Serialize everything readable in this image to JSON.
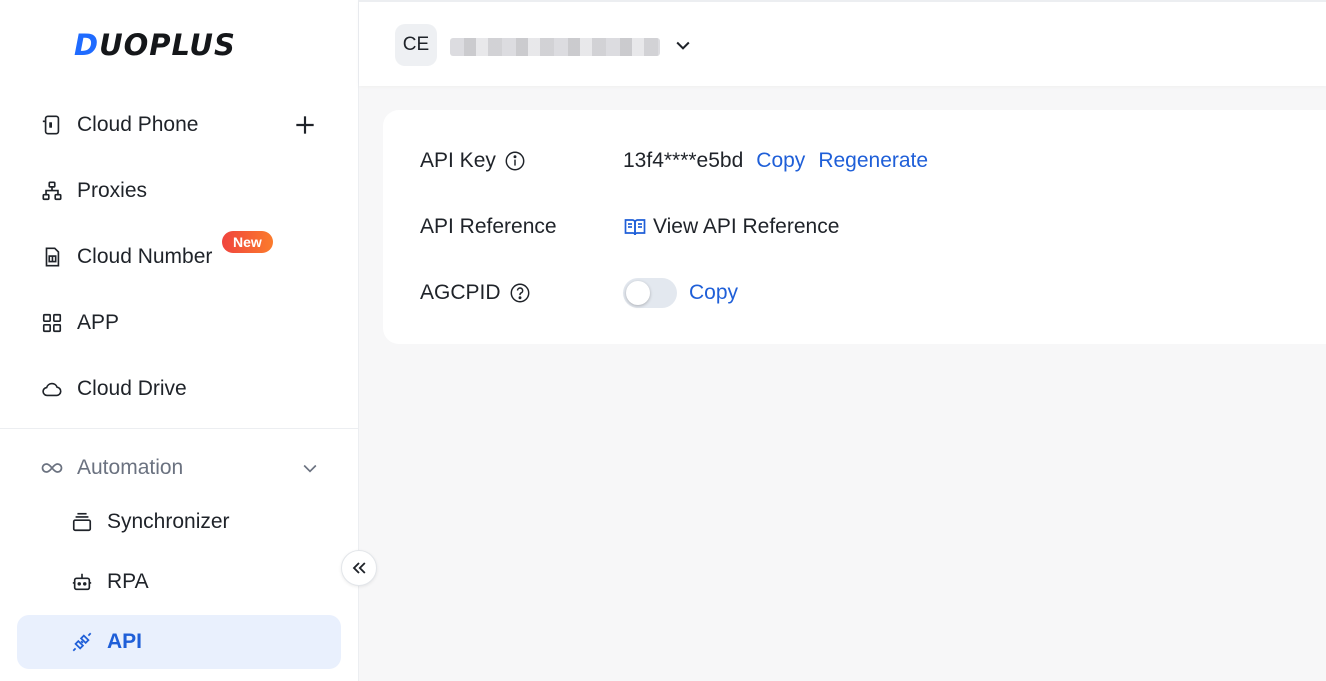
{
  "brand": {
    "logo_first": "D",
    "logo_rest": "UOPLUS"
  },
  "sidebar": {
    "items": [
      {
        "label": "Cloud Phone",
        "icon": "phone-icon"
      },
      {
        "label": "Proxies",
        "icon": "network-icon"
      },
      {
        "label": "Cloud Number",
        "icon": "sim-card-icon",
        "badge": "New"
      },
      {
        "label": "APP",
        "icon": "grid-icon"
      },
      {
        "label": "Cloud Drive",
        "icon": "cloud-icon"
      }
    ],
    "group": {
      "label": "Automation",
      "icon": "infinity-icon",
      "children": [
        {
          "label": "Synchronizer",
          "icon": "layers-icon"
        },
        {
          "label": "RPA",
          "icon": "robot-icon"
        },
        {
          "label": "API",
          "icon": "plug-icon",
          "active": true
        }
      ]
    }
  },
  "topbar": {
    "avatar_initials": "CE"
  },
  "api_panel": {
    "api_key_label": "API Key",
    "api_key_value": "13f4****e5bd",
    "copy_label": "Copy",
    "regenerate_label": "Regenerate",
    "reference_label": "API Reference",
    "reference_link": "View API Reference",
    "agcpid_label": "AGCPID",
    "agcpid_copy_label": "Copy",
    "agcpid_toggle_on": false
  },
  "colors": {
    "accent": "#1f5fd8",
    "brand_blue": "#1f6bff",
    "badge": "#f0443e"
  }
}
